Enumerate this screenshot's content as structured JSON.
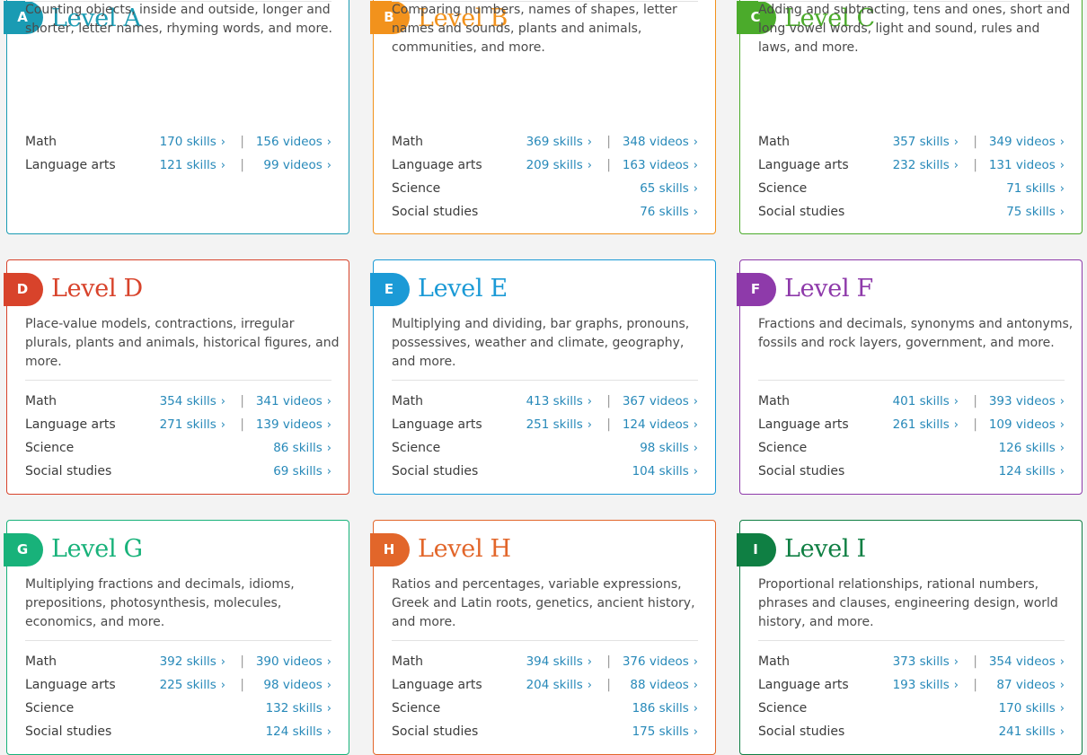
{
  "levels": [
    {
      "letter": "A",
      "title": "Level A",
      "color": "#1a9bb3",
      "description": "Counting objects, inside and outside, longer and shorter, letter names, rhyming words, and more.",
      "subjects": [
        {
          "name": "Math",
          "skills": "170 skills",
          "videos": "156 videos"
        },
        {
          "name": "Language arts",
          "skills": "121 skills",
          "videos": "99 videos"
        }
      ]
    },
    {
      "letter": "B",
      "title": "Level B",
      "color": "#f2921c",
      "description": "Comparing numbers, names of shapes, letter names and sounds, plants and animals, communities, and more.",
      "subjects": [
        {
          "name": "Math",
          "skills": "369 skills",
          "videos": "348 videos"
        },
        {
          "name": "Language arts",
          "skills": "209 skills",
          "videos": "163 videos"
        },
        {
          "name": "Science",
          "skills": "65 skills"
        },
        {
          "name": "Social studies",
          "skills": "76 skills"
        }
      ]
    },
    {
      "letter": "C",
      "title": "Level C",
      "color": "#4bab2b",
      "description": "Adding and subtracting, tens and ones, short and long vowel words, light and sound, rules and laws, and more.",
      "subjects": [
        {
          "name": "Math",
          "skills": "357 skills",
          "videos": "349 videos"
        },
        {
          "name": "Language arts",
          "skills": "232 skills",
          "videos": "131 videos"
        },
        {
          "name": "Science",
          "skills": "71 skills"
        },
        {
          "name": "Social studies",
          "skills": "75 skills"
        }
      ]
    },
    {
      "letter": "D",
      "title": "Level D",
      "color": "#d8432b",
      "description": "Place-value models, contractions, irregular plurals, plants and animals, historical figures, and more.",
      "subjects": [
        {
          "name": "Math",
          "skills": "354 skills",
          "videos": "341 videos"
        },
        {
          "name": "Language arts",
          "skills": "271 skills",
          "videos": "139 videos"
        },
        {
          "name": "Science",
          "skills": "86 skills"
        },
        {
          "name": "Social studies",
          "skills": "69 skills"
        }
      ]
    },
    {
      "letter": "E",
      "title": "Level E",
      "color": "#1b9ad6",
      "description": "Multiplying and dividing, bar graphs, pronouns, possessives, weather and climate, geography, and more.",
      "subjects": [
        {
          "name": "Math",
          "skills": "413 skills",
          "videos": "367 videos"
        },
        {
          "name": "Language arts",
          "skills": "251 skills",
          "videos": "124 videos"
        },
        {
          "name": "Science",
          "skills": "98 skills"
        },
        {
          "name": "Social studies",
          "skills": "104 skills"
        }
      ]
    },
    {
      "letter": "F",
      "title": "Level F",
      "color": "#8e3aaa",
      "description": "Fractions and decimals, synonyms and antonyms, fossils and rock layers, government, and more.",
      "subjects": [
        {
          "name": "Math",
          "skills": "401 skills",
          "videos": "393 videos"
        },
        {
          "name": "Language arts",
          "skills": "261 skills",
          "videos": "109 videos"
        },
        {
          "name": "Science",
          "skills": "126 skills"
        },
        {
          "name": "Social studies",
          "skills": "124 skills"
        }
      ]
    },
    {
      "letter": "G",
      "title": "Level G",
      "color": "#18b27a",
      "description": "Multiplying fractions and decimals, idioms, prepositions, photosynthesis, molecules, economics, and more.",
      "subjects": [
        {
          "name": "Math",
          "skills": "392 skills",
          "videos": "390 videos"
        },
        {
          "name": "Language arts",
          "skills": "225 skills",
          "videos": "98 videos"
        },
        {
          "name": "Science",
          "skills": "132 skills"
        },
        {
          "name": "Social studies",
          "skills": "124 skills"
        }
      ]
    },
    {
      "letter": "H",
      "title": "Level H",
      "color": "#e2662a",
      "description": "Ratios and percentages, variable expressions, Greek and Latin roots, genetics, ancient history, and more.",
      "subjects": [
        {
          "name": "Math",
          "skills": "394 skills",
          "videos": "376 videos"
        },
        {
          "name": "Language arts",
          "skills": "204 skills",
          "videos": "88 videos"
        },
        {
          "name": "Science",
          "skills": "186 skills"
        },
        {
          "name": "Social studies",
          "skills": "175 skills"
        }
      ]
    },
    {
      "letter": "I",
      "title": "Level I",
      "color": "#0f7f43",
      "description": "Proportional relationships, rational numbers, phrases and clauses, engineering design, world history, and more.",
      "subjects": [
        {
          "name": "Math",
          "skills": "373 skills",
          "videos": "354 videos"
        },
        {
          "name": "Language arts",
          "skills": "193 skills",
          "videos": "87 videos"
        },
        {
          "name": "Science",
          "skills": "170 skills"
        },
        {
          "name": "Social studies",
          "skills": "241 skills"
        }
      ]
    }
  ]
}
